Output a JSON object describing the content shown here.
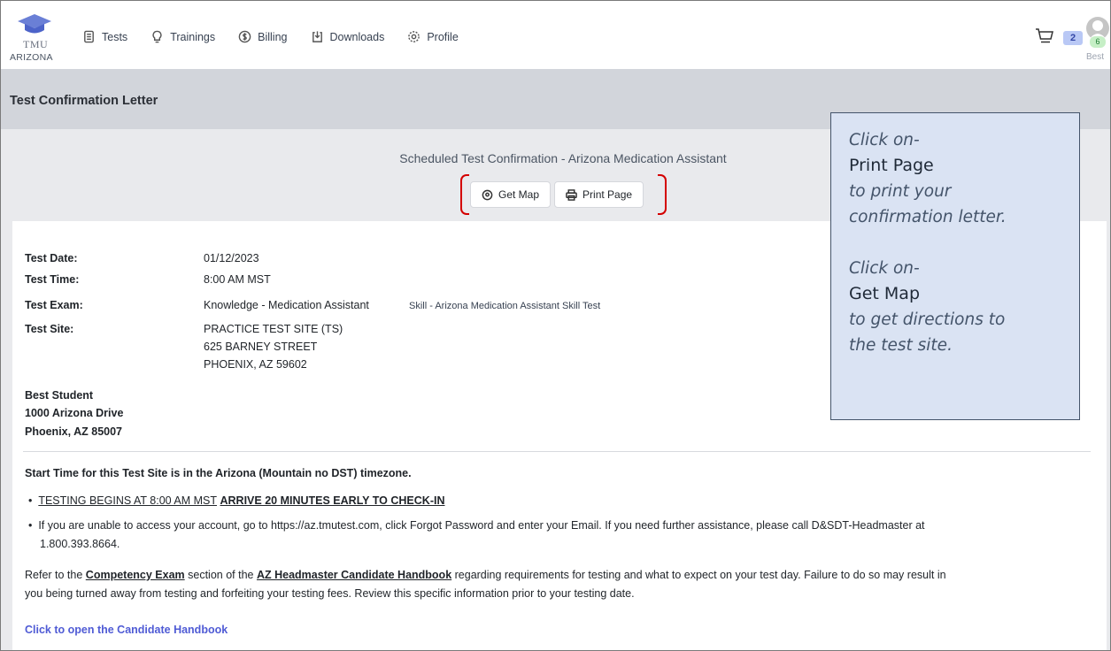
{
  "nav": {
    "logo_text": "TMU",
    "state_text": "ARIZONA",
    "links": [
      "Tests",
      "Trainings",
      "Billing",
      "Downloads",
      "Profile"
    ],
    "cart_count": "2",
    "user_badge": "6",
    "user_name": "Best"
  },
  "page": {
    "title": "Test Confirmation Letter",
    "scheduled_heading": "Scheduled Test Confirmation - Arizona Medication Assistant",
    "buttons": {
      "get_map": "Get Map",
      "print_page": "Print Page"
    }
  },
  "details": {
    "test_date_label": "Test Date:",
    "test_date": "01/12/2023",
    "test_time_label": "Test Time:",
    "test_time": "8:00 AM MST",
    "test_exam_label": "Test Exam:",
    "test_exam_knowledge": "Knowledge - Medication Assistant",
    "test_exam_skill": "Skill - Arizona Medication Assistant Skill Test",
    "test_site_label": "Test Site:",
    "site_line1": "PRACTICE TEST SITE (TS)",
    "site_line2": "625 BARNEY STREET",
    "site_line3": "PHOENIX, AZ 59602"
  },
  "candidate": {
    "name": "Best Student",
    "address1": "1000 Arizona Drive",
    "address2": "Phoenix, AZ 85007"
  },
  "notes": {
    "timezone": "Start Time for this Test Site is in the Arizona (Mountain no DST) timezone.",
    "bullet1_a": "TESTING BEGINS AT 8:00 AM MST",
    "bullet1_b": "ARRIVE 20 MINUTES EARLY TO CHECK-IN",
    "bullet2_line1": "If you are unable to access your account, go to https://az.tmutest.com, click Forgot Password and enter your Email. If you need further assistance, please call D&SDT-Headmaster at",
    "bullet2_line2": "1.800.393.8664.",
    "refer_a": "Refer to the ",
    "refer_link1": "Competency Exam",
    "refer_b": " section of the ",
    "refer_link2": "AZ Headmaster Candidate Handbook",
    "refer_c": " regarding requirements for testing and what to expect on your test day. Failure to do so may result in",
    "refer_line2": "you being turned away from testing and forfeiting your testing fees. Review this specific information prior to your testing date.",
    "handbook_link": "Click to open the Candidate Handbook"
  },
  "callout": {
    "line1": "Click on-",
    "line2": "Print Page",
    "line3": "to print your",
    "line4": "confirmation letter.",
    "line5": "Click on-",
    "line6": "Get Map",
    "line7": "to get directions to",
    "line8": "the test site."
  },
  "colors": {
    "callout_bg": "#dae3f3",
    "callout_border": "#44546a",
    "highlight": "#d40000",
    "link_blue": "#4f5bd5"
  }
}
